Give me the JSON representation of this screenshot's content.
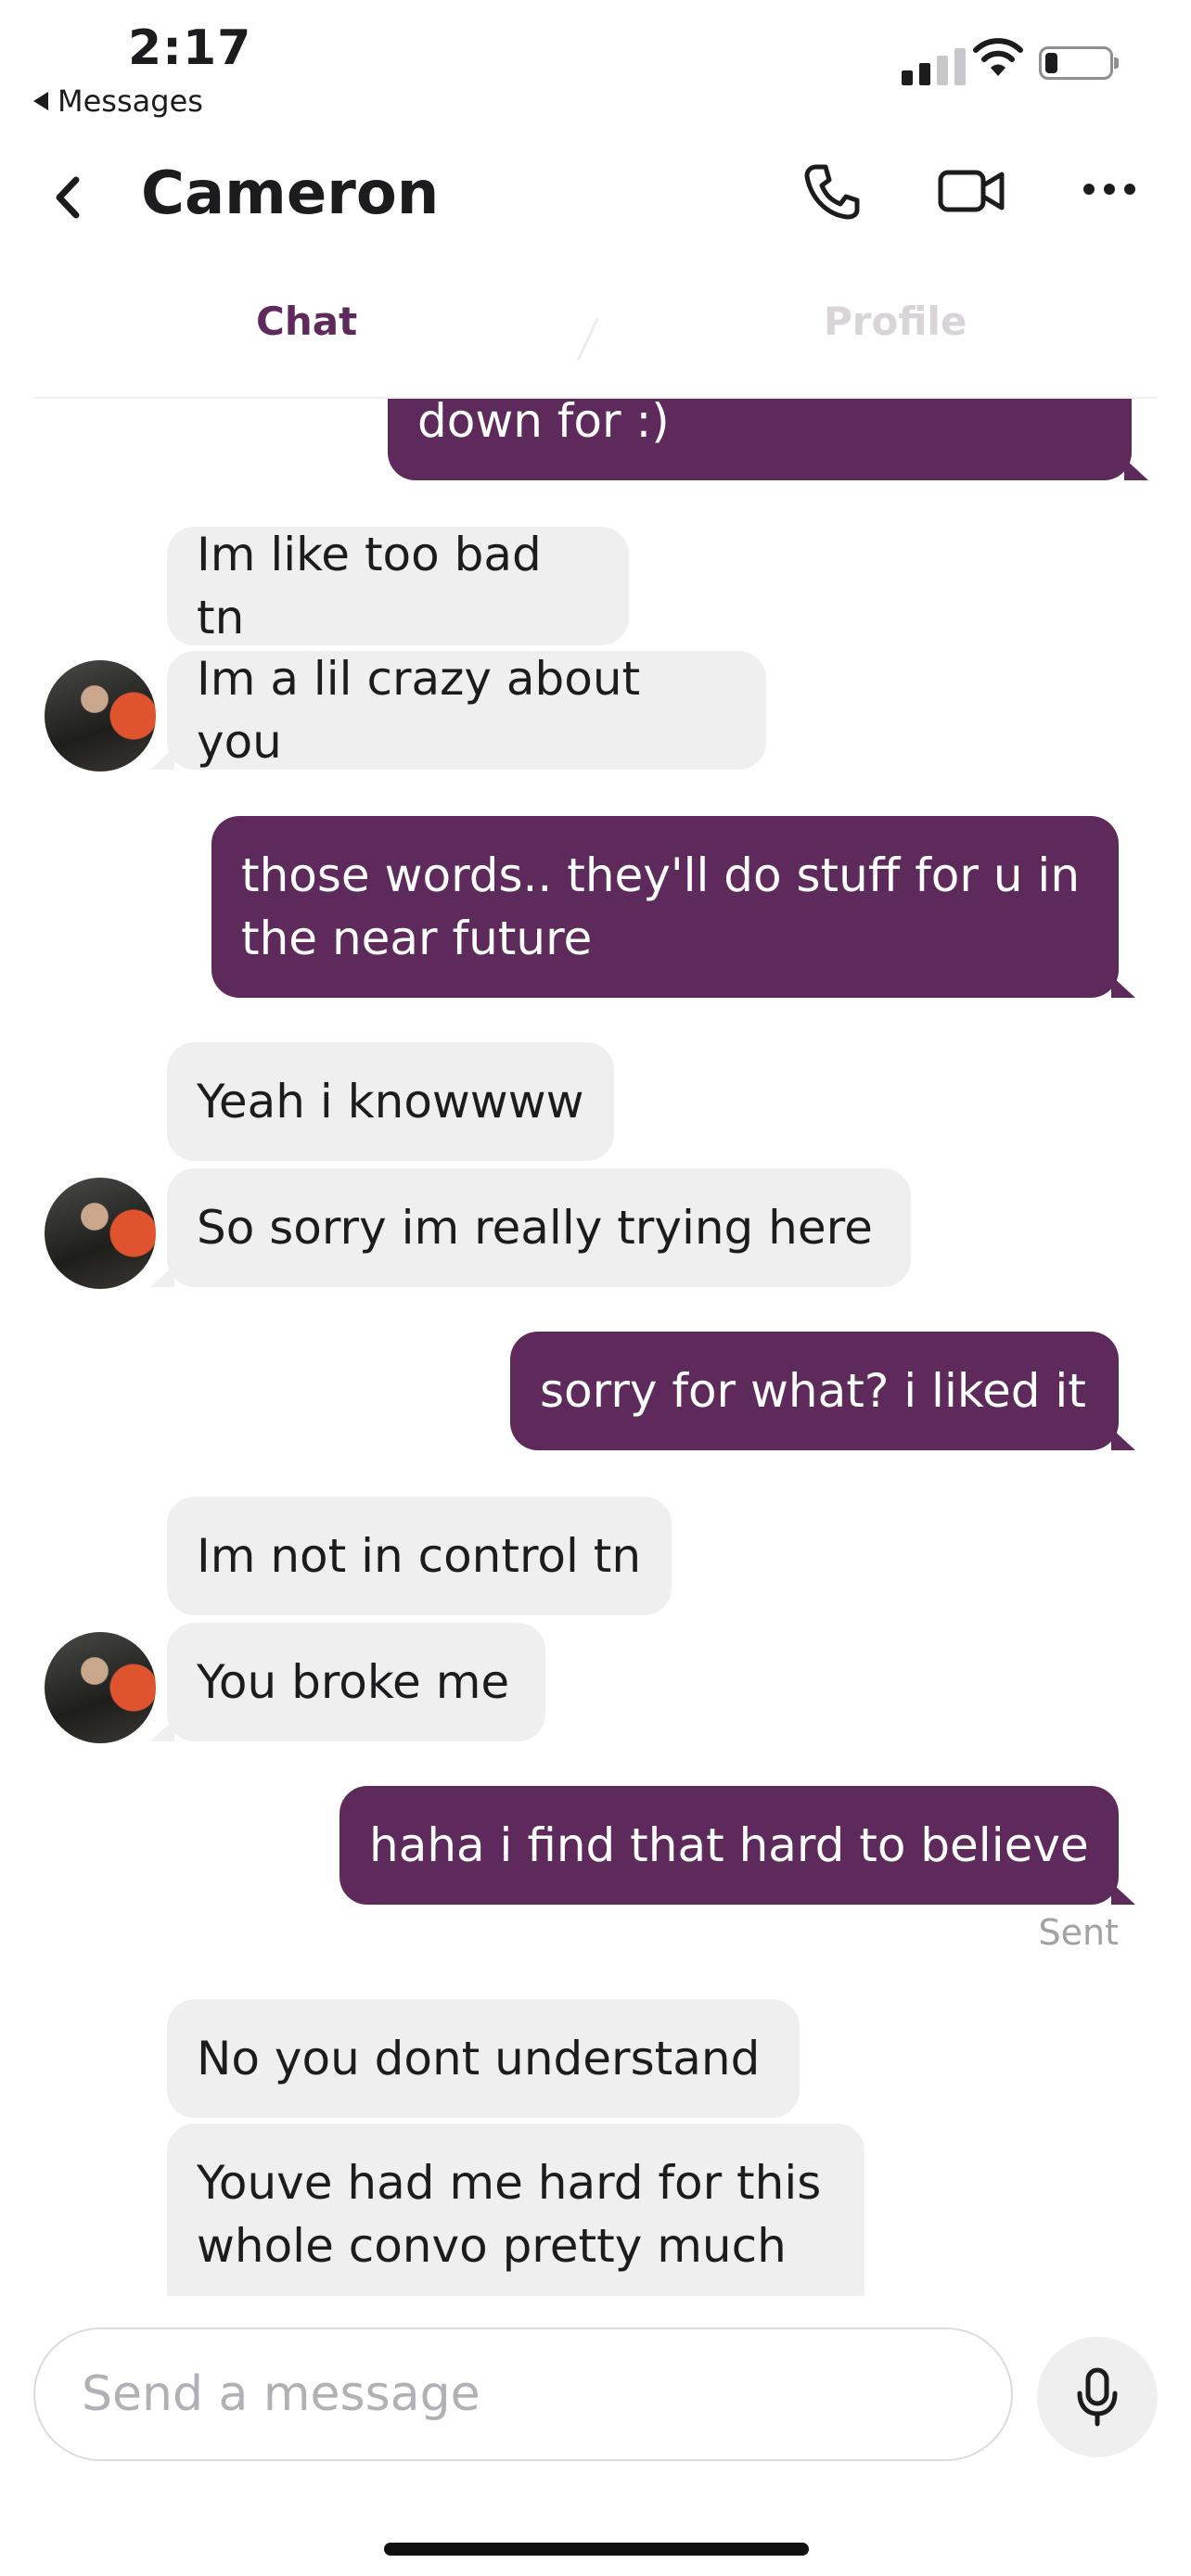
{
  "status_bar": {
    "time": "2:17",
    "back_app_label": "Messages",
    "back_icon": "triangle-left-icon",
    "signal_bars": [
      1,
      1,
      0,
      0
    ],
    "battery_level": 0.2
  },
  "header": {
    "back_icon": "chevron-left-icon",
    "title": "Cameron",
    "phone_icon": "phone-icon",
    "video_icon": "video-camera-icon",
    "more_icon": "more-icon"
  },
  "tabs": {
    "chat": "Chat",
    "profile": "Profile"
  },
  "messages": {
    "m0": "down for :)",
    "m1": "Im like too bad tn",
    "m2": "Im a lil crazy about you",
    "m3": "those words.. they'll do stuff for u in\nthe near future",
    "m4": "Yeah i knowwww",
    "m5": "So sorry im really trying here",
    "m6": "sorry for what? i liked it",
    "m7": "Im not in control tn",
    "m8": "You broke me",
    "m9": "haha i find that hard to believe",
    "m10": "No you dont understand",
    "m11": "Youve had me hard for this\nwhole convo pretty much"
  },
  "sent_label": "Sent",
  "composer": {
    "placeholder": "Send a message",
    "mic_icon": "microphone-icon"
  },
  "colors": {
    "accent": "#5e2a5c",
    "incoming_bubble": "#efefef",
    "tab_inactive": "#d9d4d8"
  }
}
